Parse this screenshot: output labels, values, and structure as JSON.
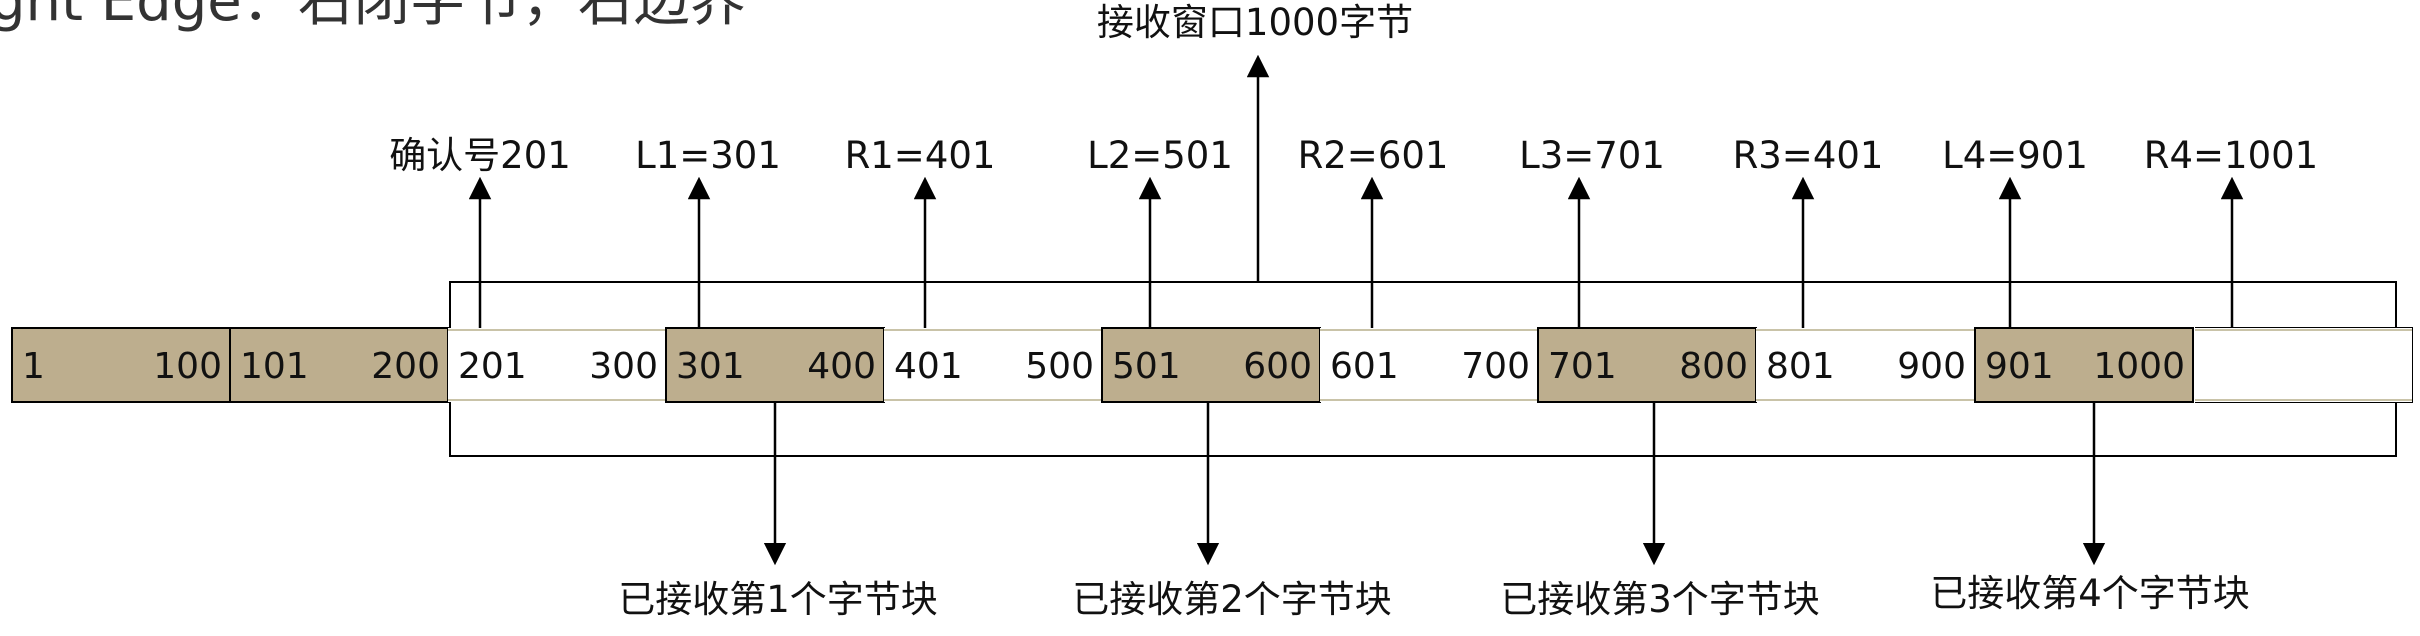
{
  "title_fragment": "ght Edge：右闭字节，右边界",
  "window_label": "接收窗口1000字节",
  "pointer_labels": [
    "确认号201",
    "L1=301",
    "R1=401",
    "L2=501",
    "R2=601",
    "L3=701",
    "R3=401",
    "L4=901",
    "R4=1001"
  ],
  "cells": [
    {
      "start": "1",
      "end": "100",
      "received": true
    },
    {
      "start": "101",
      "end": "200",
      "received": true
    },
    {
      "start": "201",
      "end": "300",
      "received": false
    },
    {
      "start": "301",
      "end": "400",
      "received": true
    },
    {
      "start": "401",
      "end": "500",
      "received": false
    },
    {
      "start": "501",
      "end": "600",
      "received": true
    },
    {
      "start": "601",
      "end": "700",
      "received": false
    },
    {
      "start": "701",
      "end": "800",
      "received": true
    },
    {
      "start": "801",
      "end": "900",
      "received": false
    },
    {
      "start": "901",
      "end": "1000",
      "received": true
    },
    {
      "start": "",
      "end": "",
      "received": false
    }
  ],
  "block_labels": [
    "已接收第1个字节块",
    "已接收第2个字节块",
    "已接收第3个字节块",
    "已接收第4个字节块"
  ],
  "colors": {
    "received_fill": "#BDAE8E",
    "empty_fill": "#FFFFFF",
    "stroke": "#000000",
    "inner_line": "#C9C3A8"
  }
}
